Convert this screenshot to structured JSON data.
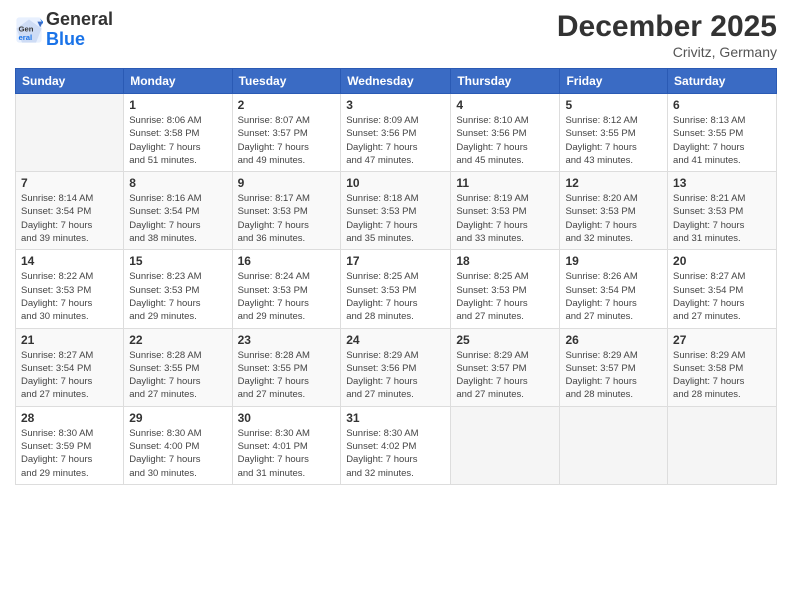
{
  "header": {
    "logo_general": "General",
    "logo_blue": "Blue",
    "month": "December 2025",
    "location": "Crivitz, Germany"
  },
  "days_of_week": [
    "Sunday",
    "Monday",
    "Tuesday",
    "Wednesday",
    "Thursday",
    "Friday",
    "Saturday"
  ],
  "weeks": [
    [
      {
        "day": "",
        "info": ""
      },
      {
        "day": "1",
        "info": "Sunrise: 8:06 AM\nSunset: 3:58 PM\nDaylight: 7 hours\nand 51 minutes."
      },
      {
        "day": "2",
        "info": "Sunrise: 8:07 AM\nSunset: 3:57 PM\nDaylight: 7 hours\nand 49 minutes."
      },
      {
        "day": "3",
        "info": "Sunrise: 8:09 AM\nSunset: 3:56 PM\nDaylight: 7 hours\nand 47 minutes."
      },
      {
        "day": "4",
        "info": "Sunrise: 8:10 AM\nSunset: 3:56 PM\nDaylight: 7 hours\nand 45 minutes."
      },
      {
        "day": "5",
        "info": "Sunrise: 8:12 AM\nSunset: 3:55 PM\nDaylight: 7 hours\nand 43 minutes."
      },
      {
        "day": "6",
        "info": "Sunrise: 8:13 AM\nSunset: 3:55 PM\nDaylight: 7 hours\nand 41 minutes."
      }
    ],
    [
      {
        "day": "7",
        "info": "Sunrise: 8:14 AM\nSunset: 3:54 PM\nDaylight: 7 hours\nand 39 minutes."
      },
      {
        "day": "8",
        "info": "Sunrise: 8:16 AM\nSunset: 3:54 PM\nDaylight: 7 hours\nand 38 minutes."
      },
      {
        "day": "9",
        "info": "Sunrise: 8:17 AM\nSunset: 3:53 PM\nDaylight: 7 hours\nand 36 minutes."
      },
      {
        "day": "10",
        "info": "Sunrise: 8:18 AM\nSunset: 3:53 PM\nDaylight: 7 hours\nand 35 minutes."
      },
      {
        "day": "11",
        "info": "Sunrise: 8:19 AM\nSunset: 3:53 PM\nDaylight: 7 hours\nand 33 minutes."
      },
      {
        "day": "12",
        "info": "Sunrise: 8:20 AM\nSunset: 3:53 PM\nDaylight: 7 hours\nand 32 minutes."
      },
      {
        "day": "13",
        "info": "Sunrise: 8:21 AM\nSunset: 3:53 PM\nDaylight: 7 hours\nand 31 minutes."
      }
    ],
    [
      {
        "day": "14",
        "info": "Sunrise: 8:22 AM\nSunset: 3:53 PM\nDaylight: 7 hours\nand 30 minutes."
      },
      {
        "day": "15",
        "info": "Sunrise: 8:23 AM\nSunset: 3:53 PM\nDaylight: 7 hours\nand 29 minutes."
      },
      {
        "day": "16",
        "info": "Sunrise: 8:24 AM\nSunset: 3:53 PM\nDaylight: 7 hours\nand 29 minutes."
      },
      {
        "day": "17",
        "info": "Sunrise: 8:25 AM\nSunset: 3:53 PM\nDaylight: 7 hours\nand 28 minutes."
      },
      {
        "day": "18",
        "info": "Sunrise: 8:25 AM\nSunset: 3:53 PM\nDaylight: 7 hours\nand 27 minutes."
      },
      {
        "day": "19",
        "info": "Sunrise: 8:26 AM\nSunset: 3:54 PM\nDaylight: 7 hours\nand 27 minutes."
      },
      {
        "day": "20",
        "info": "Sunrise: 8:27 AM\nSunset: 3:54 PM\nDaylight: 7 hours\nand 27 minutes."
      }
    ],
    [
      {
        "day": "21",
        "info": "Sunrise: 8:27 AM\nSunset: 3:54 PM\nDaylight: 7 hours\nand 27 minutes."
      },
      {
        "day": "22",
        "info": "Sunrise: 8:28 AM\nSunset: 3:55 PM\nDaylight: 7 hours\nand 27 minutes."
      },
      {
        "day": "23",
        "info": "Sunrise: 8:28 AM\nSunset: 3:55 PM\nDaylight: 7 hours\nand 27 minutes."
      },
      {
        "day": "24",
        "info": "Sunrise: 8:29 AM\nSunset: 3:56 PM\nDaylight: 7 hours\nand 27 minutes."
      },
      {
        "day": "25",
        "info": "Sunrise: 8:29 AM\nSunset: 3:57 PM\nDaylight: 7 hours\nand 27 minutes."
      },
      {
        "day": "26",
        "info": "Sunrise: 8:29 AM\nSunset: 3:57 PM\nDaylight: 7 hours\nand 28 minutes."
      },
      {
        "day": "27",
        "info": "Sunrise: 8:29 AM\nSunset: 3:58 PM\nDaylight: 7 hours\nand 28 minutes."
      }
    ],
    [
      {
        "day": "28",
        "info": "Sunrise: 8:30 AM\nSunset: 3:59 PM\nDaylight: 7 hours\nand 29 minutes."
      },
      {
        "day": "29",
        "info": "Sunrise: 8:30 AM\nSunset: 4:00 PM\nDaylight: 7 hours\nand 30 minutes."
      },
      {
        "day": "30",
        "info": "Sunrise: 8:30 AM\nSunset: 4:01 PM\nDaylight: 7 hours\nand 31 minutes."
      },
      {
        "day": "31",
        "info": "Sunrise: 8:30 AM\nSunset: 4:02 PM\nDaylight: 7 hours\nand 32 minutes."
      },
      {
        "day": "",
        "info": ""
      },
      {
        "day": "",
        "info": ""
      },
      {
        "day": "",
        "info": ""
      }
    ]
  ]
}
